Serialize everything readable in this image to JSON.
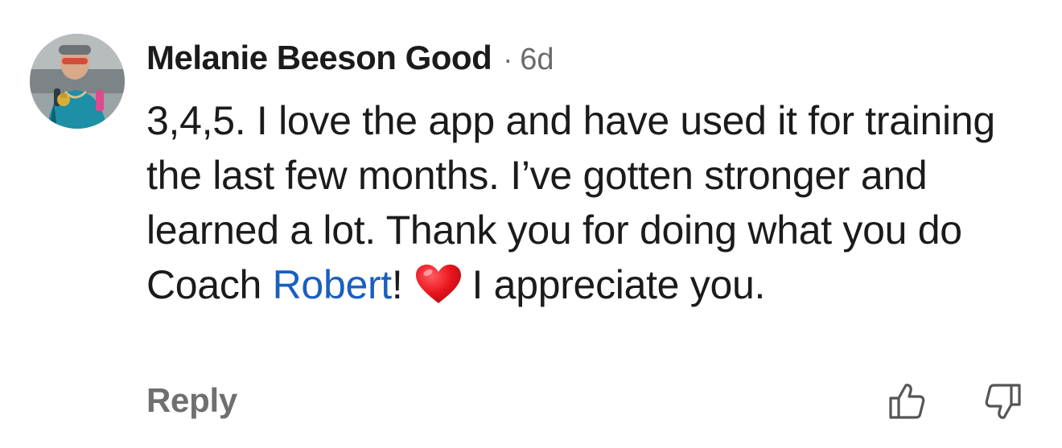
{
  "comment": {
    "author": "Melanie Beeson Good",
    "separator": "·",
    "time_ago": "6d",
    "text_before_mention": "3,4,5. I love the app and have used it for training the last few months. I’ve gotten stronger and learned a lot. Thank you for doing what you do Coach ",
    "mention": "Robert",
    "text_after_mention": "!",
    "emoji": "heart-emoji",
    "text_after_emoji": "I appreciate you.",
    "mention_color": "#1a5fc0",
    "emoji_color": "#e8141c"
  },
  "actions": {
    "reply_label": "Reply",
    "upvote_icon": "thumbs-up-icon",
    "downvote_icon": "thumbs-down-icon"
  }
}
